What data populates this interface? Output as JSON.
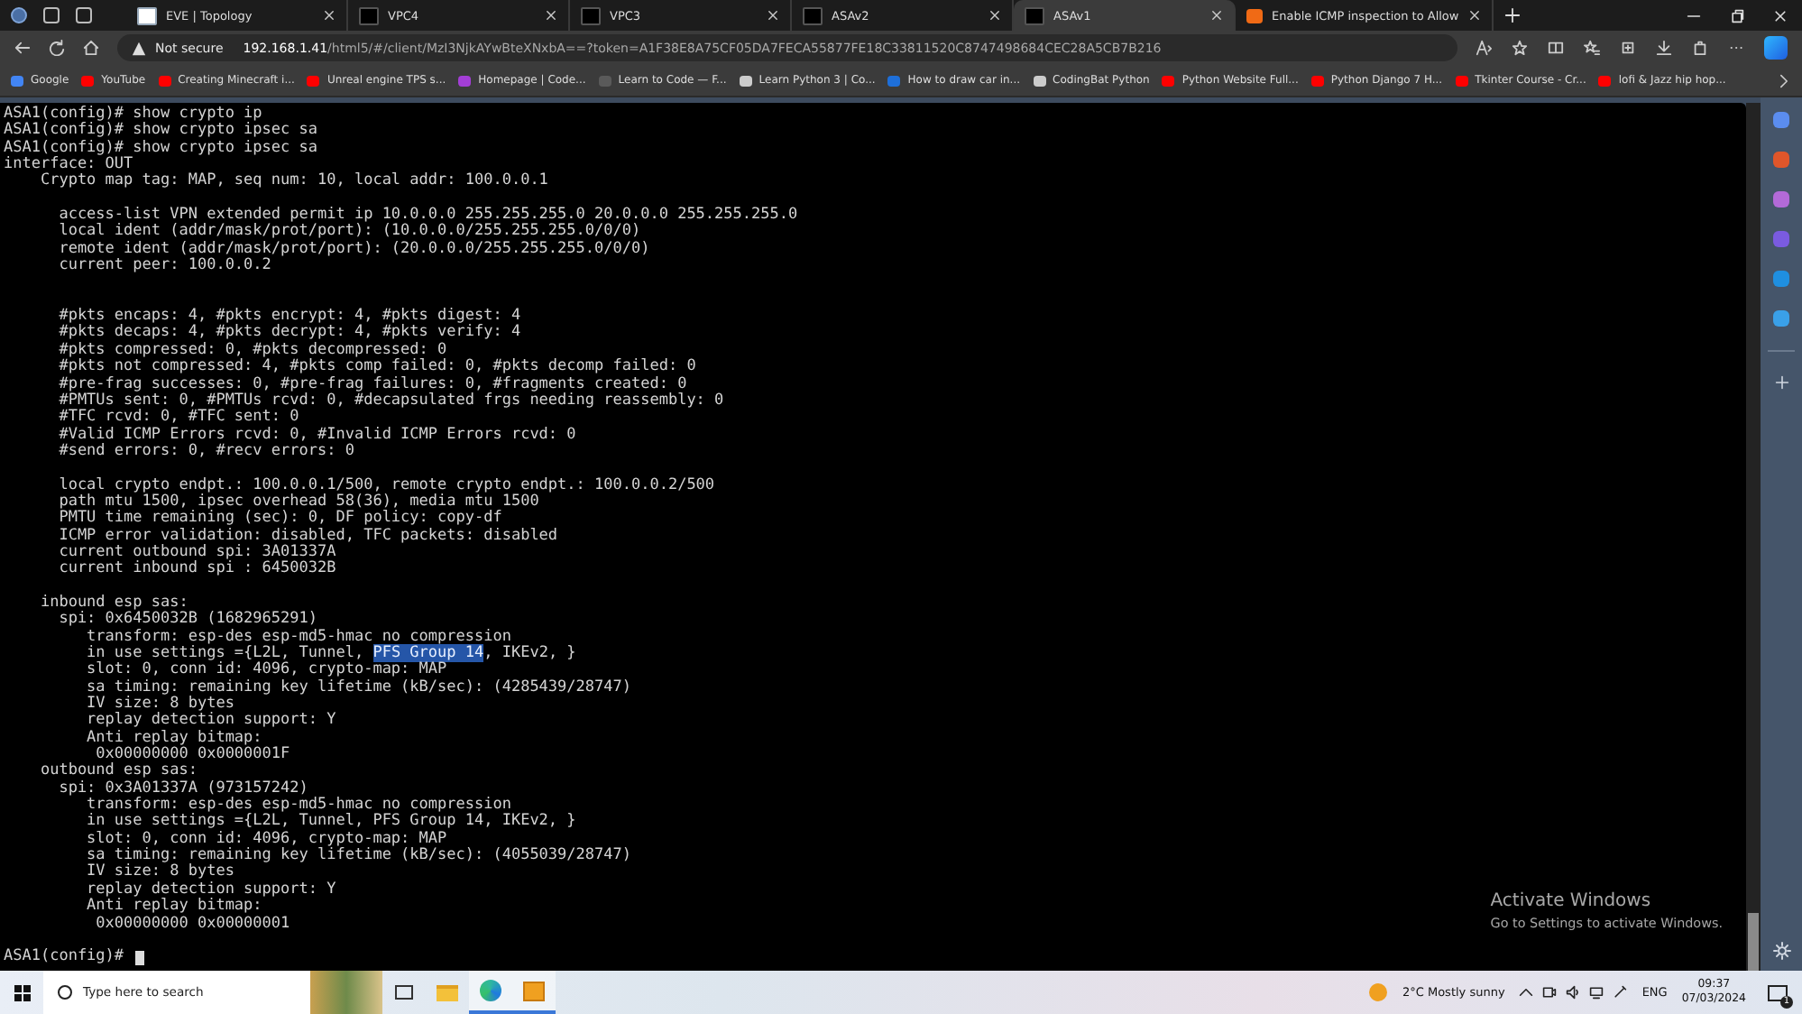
{
  "tabs": [
    {
      "title": "EVE | Topology",
      "kind": "site",
      "selected": false
    },
    {
      "title": "VPC4",
      "kind": "console",
      "selected": false
    },
    {
      "title": "VPC3",
      "kind": "console",
      "selected": false
    },
    {
      "title": "ASAv2",
      "kind": "console",
      "selected": false
    },
    {
      "title": "ASAv1",
      "kind": "console",
      "selected": true
    },
    {
      "title": "Enable ICMP inspection to Allow",
      "kind": "forum",
      "selected": false
    }
  ],
  "address_bar": {
    "security": "Not secure",
    "host": "192.168.1.41",
    "path": "/html5/#/client/MzI3NjkAYwBteXNxbA==?token=A1F38E8A75CF05DA7FECA55877FE18C33811520C8747498684CEC28A5CB7B216"
  },
  "bookmarks": [
    {
      "label": "Google",
      "color": "#4285f4"
    },
    {
      "label": "YouTube",
      "color": "#ff0000"
    },
    {
      "label": "Creating Minecraft i...",
      "color": "#ff0000"
    },
    {
      "label": "Unreal engine TPS s...",
      "color": "#ff0000"
    },
    {
      "label": "Homepage | Code...",
      "color": "#a33ed6"
    },
    {
      "label": "Learn to Code — F...",
      "color": "#5a5a5a"
    },
    {
      "label": "Learn Python 3 | Co...",
      "color": "#cccccc"
    },
    {
      "label": "How to draw car in...",
      "color": "#1e6fd9"
    },
    {
      "label": "CodingBat Python",
      "color": "#cccccc"
    },
    {
      "label": "Python Website Full...",
      "color": "#ff0000"
    },
    {
      "label": "Python Django 7 H...",
      "color": "#ff0000"
    },
    {
      "label": "Tkinter Course - Cr...",
      "color": "#ff0000"
    },
    {
      "label": "lofi & Jazz hip hop...",
      "color": "#ff0000"
    }
  ],
  "terminal": {
    "lines": [
      {
        "kind": "text",
        "text": "ASA1(config)# show crypto ip"
      },
      {
        "kind": "text",
        "text": "ASA1(config)# show crypto ipsec sa"
      },
      {
        "kind": "text",
        "text": "ASA1(config)# show crypto ipsec sa"
      },
      {
        "kind": "text",
        "text": "interface: OUT"
      },
      {
        "kind": "text",
        "text": "    Crypto map tag: MAP, seq num: 10, local addr: 100.0.0.1"
      },
      {
        "kind": "gap"
      },
      {
        "kind": "text",
        "text": "      access-list VPN extended permit ip 10.0.0.0 255.255.255.0 20.0.0.0 255.255.255.0"
      },
      {
        "kind": "text",
        "text": "      local ident (addr/mask/prot/port): (10.0.0.0/255.255.255.0/0/0)"
      },
      {
        "kind": "text",
        "text": "      remote ident (addr/mask/prot/port): (20.0.0.0/255.255.255.0/0/0)"
      },
      {
        "kind": "text",
        "text": "      current peer: 100.0.0.2"
      },
      {
        "kind": "gap"
      },
      {
        "kind": "gap"
      },
      {
        "kind": "text",
        "text": "      #pkts encaps: 4, #pkts encrypt: 4, #pkts digest: 4"
      },
      {
        "kind": "text",
        "text": "      #pkts decaps: 4, #pkts decrypt: 4, #pkts verify: 4"
      },
      {
        "kind": "text",
        "text": "      #pkts compressed: 0, #pkts decompressed: 0"
      },
      {
        "kind": "text",
        "text": "      #pkts not compressed: 4, #pkts comp failed: 0, #pkts decomp failed: 0"
      },
      {
        "kind": "text",
        "text": "      #pre-frag successes: 0, #pre-frag failures: 0, #fragments created: 0"
      },
      {
        "kind": "text",
        "text": "      #PMTUs sent: 0, #PMTUs rcvd: 0, #decapsulated frgs needing reassembly: 0"
      },
      {
        "kind": "text",
        "text": "      #TFC rcvd: 0, #TFC sent: 0"
      },
      {
        "kind": "text",
        "text": "      #Valid ICMP Errors rcvd: 0, #Invalid ICMP Errors rcvd: 0"
      },
      {
        "kind": "text",
        "text": "      #send errors: 0, #recv errors: 0"
      },
      {
        "kind": "gap"
      },
      {
        "kind": "text",
        "text": "      local crypto endpt.: 100.0.0.1/500, remote crypto endpt.: 100.0.0.2/500"
      },
      {
        "kind": "text",
        "text": "      path mtu 1500, ipsec overhead 58(36), media mtu 1500"
      },
      {
        "kind": "text",
        "text": "      PMTU time remaining (sec): 0, DF policy: copy-df"
      },
      {
        "kind": "text",
        "text": "      ICMP error validation: disabled, TFC packets: disabled"
      },
      {
        "kind": "text",
        "text": "      current outbound spi: 3A01337A"
      },
      {
        "kind": "text",
        "text": "      current inbound spi : 6450032B"
      },
      {
        "kind": "gap"
      },
      {
        "kind": "text",
        "text": "    inbound esp sas:"
      },
      {
        "kind": "text",
        "text": "      spi: 0x6450032B (1682965291)"
      },
      {
        "kind": "text",
        "text": "         transform: esp-des esp-md5-hmac no compression"
      },
      {
        "kind": "highlight",
        "before": "         in use settings ={L2L, Tunnel, ",
        "highlight": "PFS Group 14",
        "after": ", IKEv2, }"
      },
      {
        "kind": "text",
        "text": "         slot: 0, conn id: 4096, crypto-map: MAP"
      },
      {
        "kind": "text",
        "text": "         sa timing: remaining key lifetime (kB/sec): (4285439/28747)"
      },
      {
        "kind": "text",
        "text": "         IV size: 8 bytes"
      },
      {
        "kind": "text",
        "text": "         replay detection support: Y"
      },
      {
        "kind": "text",
        "text": "         Anti replay bitmap:"
      },
      {
        "kind": "text",
        "text": "          0x00000000 0x0000001F"
      },
      {
        "kind": "text",
        "text": "    outbound esp sas:"
      },
      {
        "kind": "text",
        "text": "      spi: 0x3A01337A (973157242)"
      },
      {
        "kind": "text",
        "text": "         transform: esp-des esp-md5-hmac no compression"
      },
      {
        "kind": "text",
        "text": "         in use settings ={L2L, Tunnel, PFS Group 14, IKEv2, }"
      },
      {
        "kind": "text",
        "text": "         slot: 0, conn id: 4096, crypto-map: MAP"
      },
      {
        "kind": "text",
        "text": "         sa timing: remaining key lifetime (kB/sec): (4055039/28747)"
      },
      {
        "kind": "text",
        "text": "         IV size: 8 bytes"
      },
      {
        "kind": "text",
        "text": "         replay detection support: Y"
      },
      {
        "kind": "text",
        "text": "         Anti replay bitmap:"
      },
      {
        "kind": "text",
        "text": "          0x00000000 0x00000001"
      },
      {
        "kind": "gap"
      },
      {
        "kind": "prompt",
        "text": "ASA1(config)# "
      }
    ]
  },
  "activation_notice": {
    "title": "Activate Windows",
    "subtitle": "Go to Settings to activate Windows."
  },
  "taskbar": {
    "search_placeholder": "Type here to search",
    "weather": "2°C  Mostly sunny",
    "language": "ENG",
    "time": "09:37",
    "date": "07/03/2024",
    "notifications": "1"
  }
}
